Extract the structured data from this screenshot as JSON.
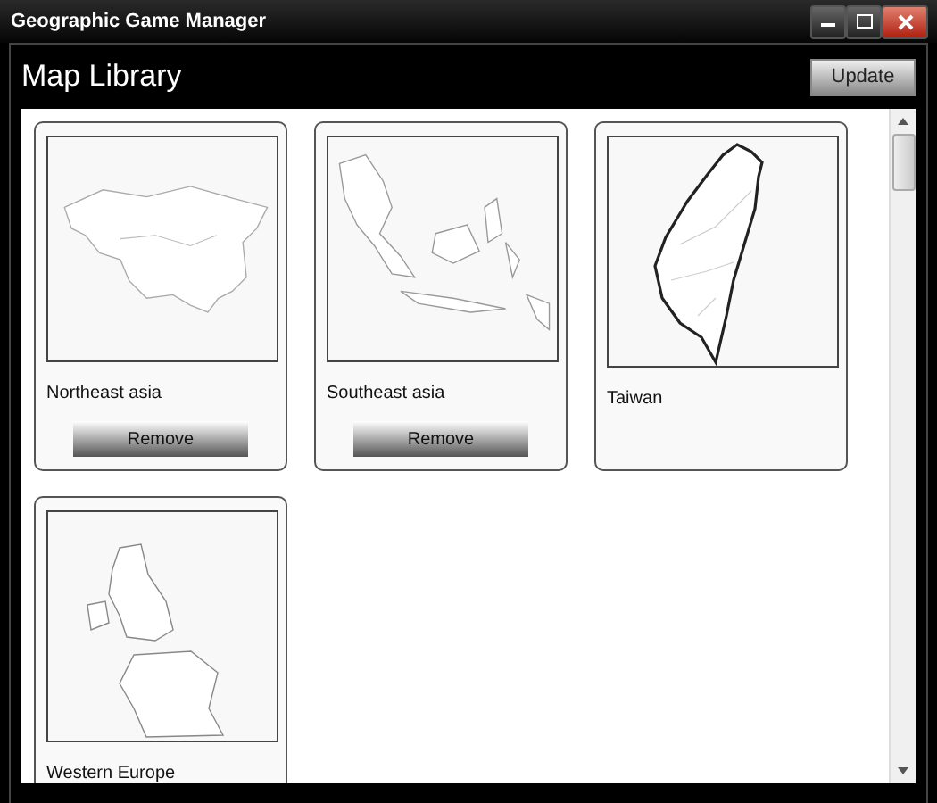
{
  "window": {
    "title": "Geographic Game Manager"
  },
  "header": {
    "title": "Map Library",
    "button": "Update"
  },
  "maps": [
    {
      "name": "Northeast asia",
      "button": "Remove"
    },
    {
      "name": "Southeast asia",
      "button": "Remove"
    },
    {
      "name": "Taiwan"
    },
    {
      "name": "Western Europe"
    }
  ]
}
